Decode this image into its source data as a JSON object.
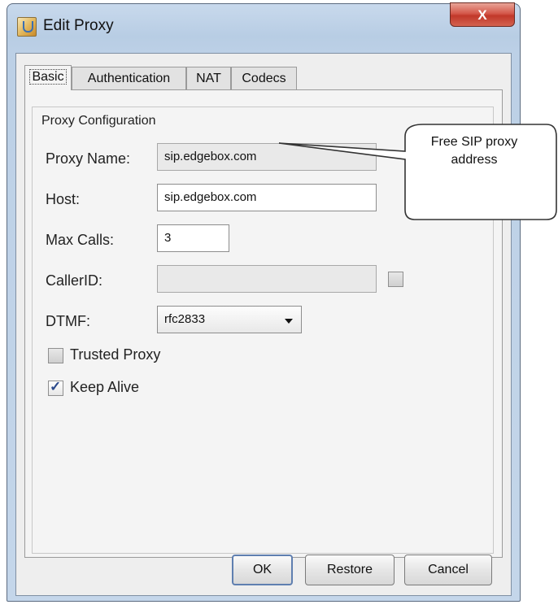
{
  "window": {
    "title": "Edit Proxy",
    "close_label": "X"
  },
  "tabs": [
    {
      "label": "Basic",
      "active": true
    },
    {
      "label": "Authentication",
      "active": false
    },
    {
      "label": "NAT",
      "active": false
    },
    {
      "label": "Codecs",
      "active": false
    }
  ],
  "group": {
    "title": "Proxy Configuration"
  },
  "fields": {
    "proxy_name": {
      "label": "Proxy Name:",
      "value": "sip.edgebox.com",
      "disabled": true
    },
    "host": {
      "label": "Host:",
      "value": "sip.edgebox.com"
    },
    "max_calls": {
      "label": "Max Calls:",
      "value": "3"
    },
    "caller_id": {
      "label": "CallerID:",
      "value": "",
      "disabled": true,
      "checked": false
    },
    "dtmf": {
      "label": "DTMF:",
      "value": "rfc2833"
    }
  },
  "checkboxes": {
    "trusted_proxy": {
      "label": "Trusted Proxy",
      "checked": false
    },
    "keep_alive": {
      "label": "Keep Alive",
      "checked": true
    }
  },
  "buttons": {
    "ok": "OK",
    "restore": "Restore",
    "cancel": "Cancel"
  },
  "callout": {
    "line1": "Free SIP proxy",
    "line2": "address"
  },
  "colors": {
    "title_bar": "#c8d9ec",
    "close_button": "#c1382a",
    "panel": "#f4f4f4",
    "check_accent": "#2b4a8c"
  }
}
